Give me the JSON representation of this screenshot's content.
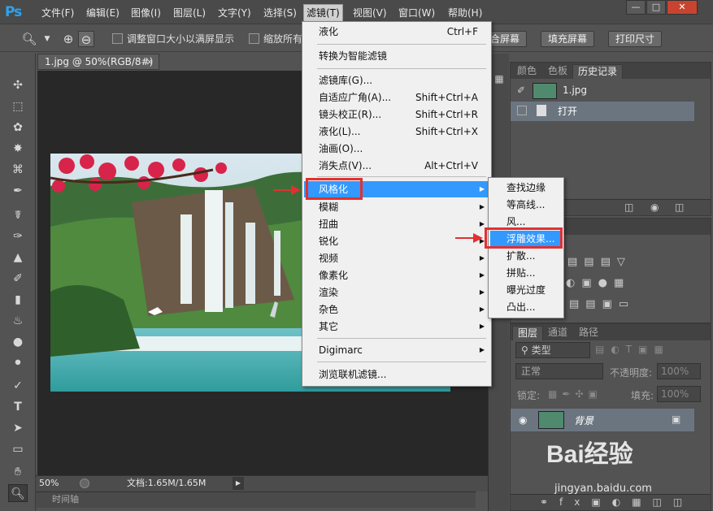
{
  "app": {
    "logo": "Ps"
  },
  "menubar": {
    "items": [
      "文件(F)",
      "编辑(E)",
      "图像(I)",
      "图层(L)",
      "文字(Y)",
      "选择(S)",
      "滤镜(T)",
      "视图(V)",
      "窗口(W)",
      "帮助(H)"
    ],
    "active": "滤镜(T)"
  },
  "window_controls": {
    "minimize": "—",
    "restore": "□",
    "close": "✕"
  },
  "options": {
    "resize_label": "调整窗口大小以满屏显示",
    "zoom_all_label": "缩放所有",
    "fit_button": "合屏幕",
    "fill_button": "填充屏幕",
    "print_button": "打印尺寸"
  },
  "document": {
    "tab_title": "1.jpg @ 50%(RGB/8#)",
    "zoom": "50%",
    "doc_info": "文档:1.65M/1.65M"
  },
  "timeline": {
    "label": "时间轴"
  },
  "filter_menu": {
    "items": [
      {
        "label": "液化",
        "shortcut": "Ctrl+F"
      },
      {
        "label": "转换为智能滤镜",
        "shortcut": ""
      },
      {
        "label": "滤镜库(G)...",
        "shortcut": ""
      },
      {
        "label": "自适应广角(A)...",
        "shortcut": "Shift+Ctrl+A"
      },
      {
        "label": "镜头校正(R)...",
        "shortcut": "Shift+Ctrl+R"
      },
      {
        "label": "液化(L)...",
        "shortcut": "Shift+Ctrl+X"
      },
      {
        "label": "油画(O)...",
        "shortcut": ""
      },
      {
        "label": "消失点(V)...",
        "shortcut": "Alt+Ctrl+V"
      },
      {
        "label": "风格化",
        "shortcut": ""
      },
      {
        "label": "模糊",
        "shortcut": ""
      },
      {
        "label": "扭曲",
        "shortcut": ""
      },
      {
        "label": "锐化",
        "shortcut": ""
      },
      {
        "label": "视频",
        "shortcut": ""
      },
      {
        "label": "像素化",
        "shortcut": ""
      },
      {
        "label": "渲染",
        "shortcut": ""
      },
      {
        "label": "杂色",
        "shortcut": ""
      },
      {
        "label": "其它",
        "shortcut": ""
      },
      {
        "label": "Digimarc",
        "shortcut": ""
      },
      {
        "label": "浏览联机滤镜...",
        "shortcut": ""
      }
    ],
    "highlighted": "风格化"
  },
  "stylize_submenu": {
    "items": [
      "查找边缘",
      "等高线...",
      "风...",
      "浮雕效果...",
      "扩散...",
      "拼贴...",
      "曝光过度",
      "凸出..."
    ],
    "highlighted": "浮雕效果..."
  },
  "history_panel": {
    "tabs": [
      "颜色",
      "色板",
      "历史记录"
    ],
    "active_tab": "历史记录",
    "snapshot": "1.jpg",
    "states": [
      "打开"
    ]
  },
  "layers_panel": {
    "tabs": [
      "图层",
      "通道",
      "路径"
    ],
    "active_tab": "图层",
    "filter_kind": "类型",
    "blend_mode": "正常",
    "opacity_label": "不透明度:",
    "opacity_value": "100%",
    "lock_label": "锁定:",
    "fill_label": "填充:",
    "fill_value": "100%",
    "layers": [
      {
        "name": "背景",
        "locked": true,
        "visible": true
      }
    ]
  },
  "watermark": {
    "brand": "Bai经验",
    "url": "jingyan.baidu.com"
  },
  "colors": {
    "accent": "#3399ff",
    "highlight_box": "#e23030",
    "ps_blue": "#2fa2ee"
  }
}
